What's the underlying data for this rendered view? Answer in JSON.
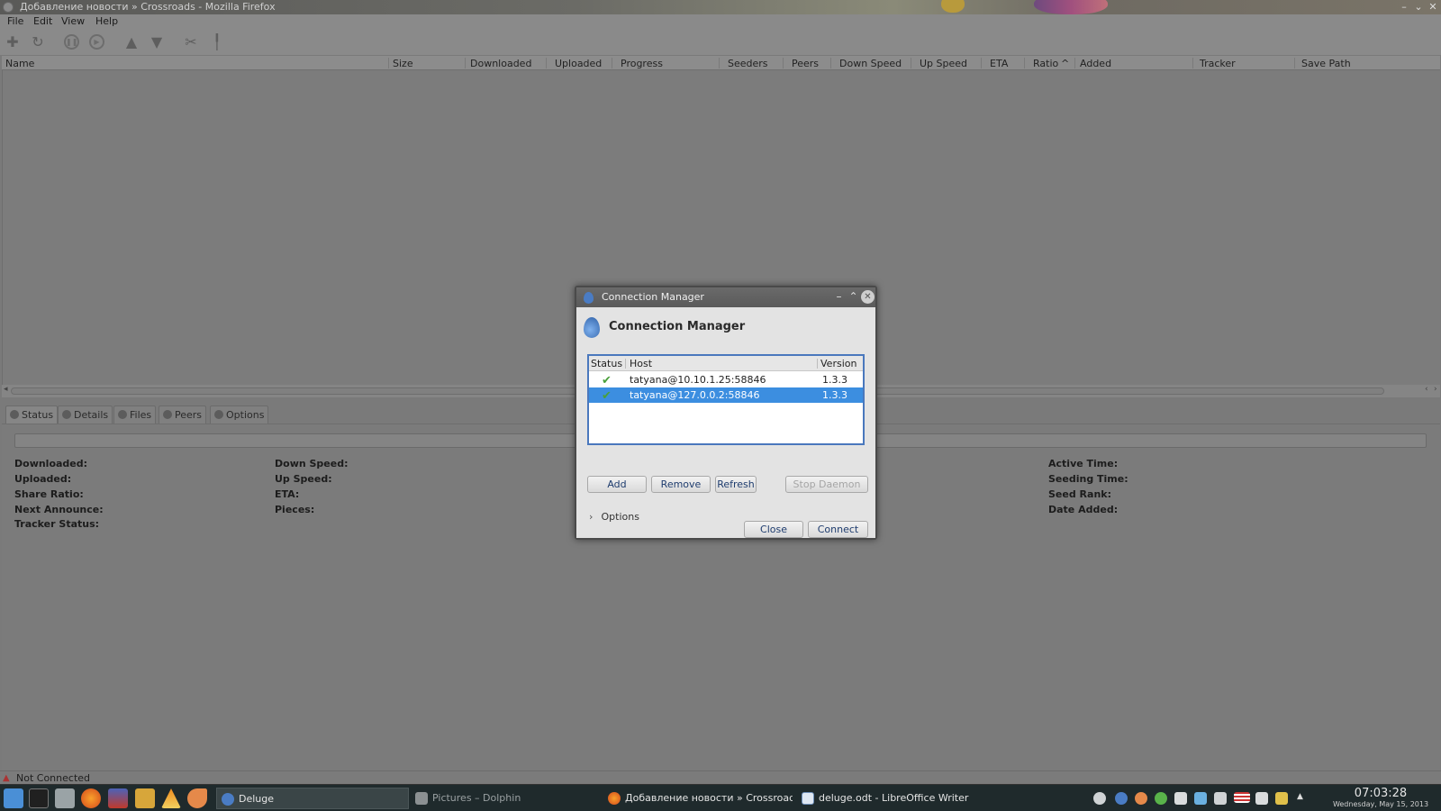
{
  "window": {
    "title": "Добавление новости » Crossroads - Mozilla Firefox"
  },
  "menu": [
    "File",
    "Edit",
    "View",
    "Help"
  ],
  "toolbar_icons": [
    "add-icon",
    "remove-icon",
    "pause-icon",
    "resume-icon",
    "queue-up-icon",
    "queue-down-icon",
    "preferences-icon",
    "connection-manager-icon"
  ],
  "columns": [
    "Name",
    "Size",
    "Downloaded",
    "Uploaded",
    "Progress",
    "Seeders",
    "Peers",
    "Down Speed",
    "Up Speed",
    "ETA",
    "Ratio",
    "Added",
    "Tracker",
    "Save Path"
  ],
  "tabs": [
    "Status",
    "Details",
    "Files",
    "Peers",
    "Options"
  ],
  "status_labels": {
    "col1": [
      "Downloaded:",
      "Uploaded:",
      "Share Ratio:",
      "Next Announce:",
      "Tracker Status:"
    ],
    "col2": [
      "Down Speed:",
      "Up Speed:",
      "ETA:",
      "Pieces:"
    ],
    "col3": [
      "Active Time:",
      "Seeding Time:",
      "Seed Rank:",
      "Date Added:"
    ]
  },
  "statusbar": {
    "text": "Not Connected"
  },
  "dialog": {
    "title": "Connection Manager",
    "heading": "Connection Manager",
    "columns": {
      "status": "Status",
      "host": "Host",
      "version": "Version"
    },
    "hosts": [
      {
        "host": "tatyana@10.10.1.25:58846",
        "version": "1.3.3",
        "selected": false
      },
      {
        "host": "tatyana@127.0.0.2:58846",
        "version": "1.3.3",
        "selected": true
      }
    ],
    "buttons": {
      "add": "Add",
      "remove": "Remove",
      "refresh": "Refresh",
      "stop_daemon": "Stop Daemon",
      "close": "Close",
      "connect": "Connect"
    },
    "options_label": "Options"
  },
  "taskbar": {
    "tasks": [
      {
        "label": "Deluge",
        "active": true
      },
      {
        "label": "Pictures – Dolphin",
        "active": false
      },
      {
        "label": "Добавление новости » Crossroad",
        "active": false
      },
      {
        "label": "deluge.odt - LibreOffice Writer",
        "active": false
      }
    ],
    "clock": {
      "time": "07:03:28",
      "date": "Wednesday, May 15, 2013"
    }
  },
  "colors": {
    "accent": "#3c8ee0",
    "dialog_border": "#4a78bd",
    "check": "#4aa03a"
  }
}
